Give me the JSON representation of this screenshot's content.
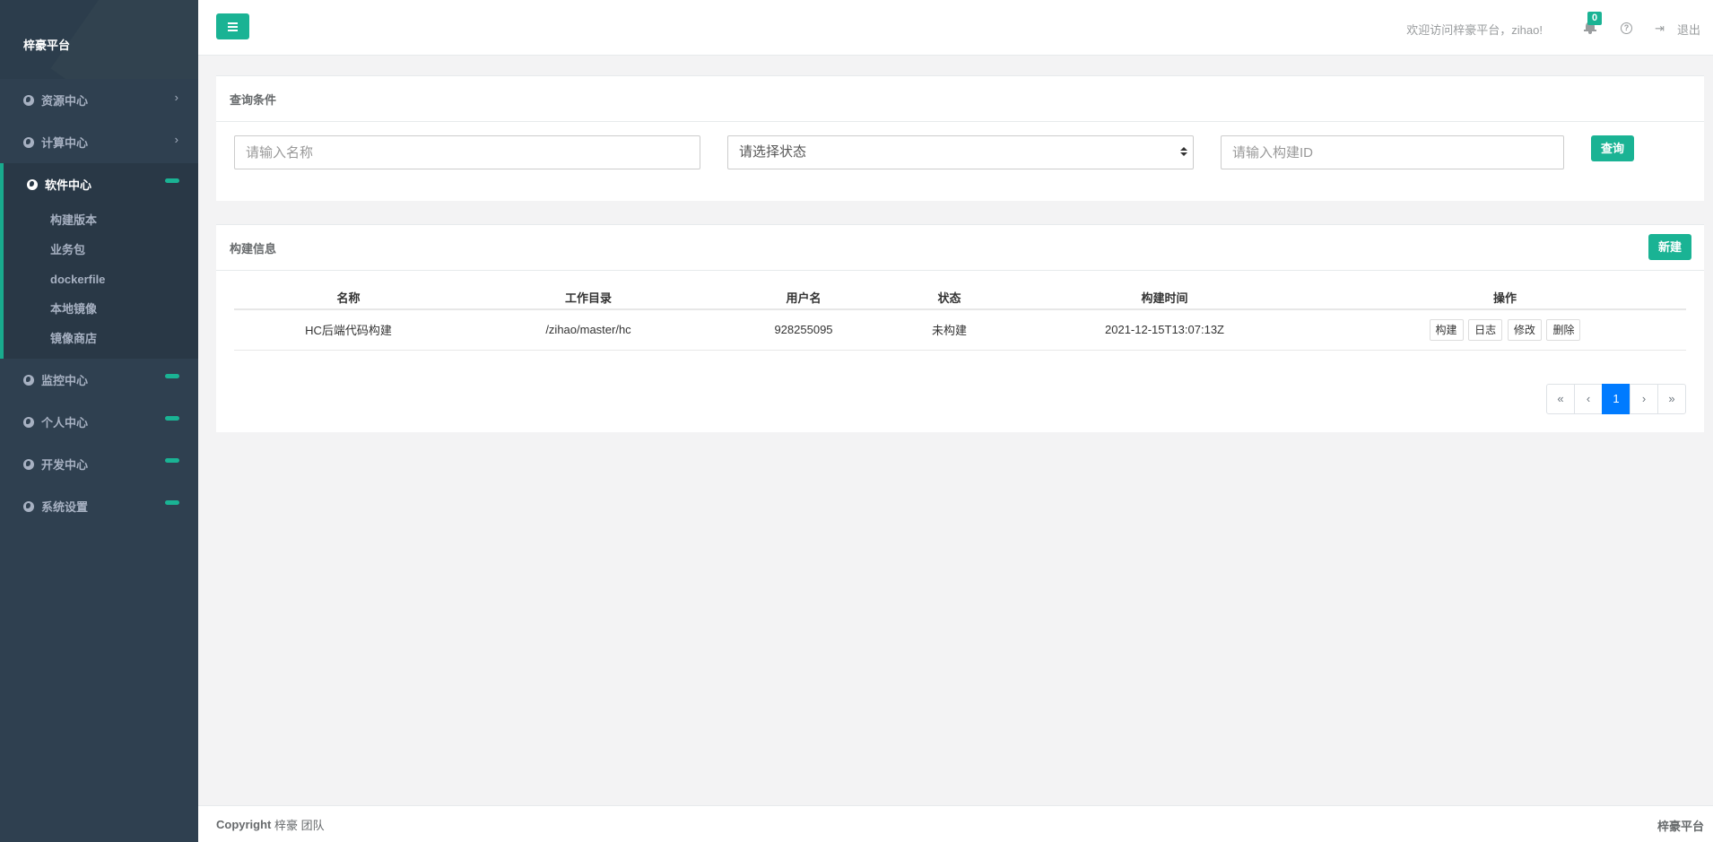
{
  "sidebar": {
    "brand": "梓豪平台",
    "items": [
      {
        "label": "资源中心",
        "marker": "arrow"
      },
      {
        "label": "计算中心",
        "marker": "arrow"
      }
    ],
    "active": {
      "label": "软件中心",
      "children": [
        "构建版本",
        "业务包",
        "dockerfile",
        "本地镜像",
        "镜像商店"
      ]
    },
    "after": [
      {
        "label": "监控中心"
      },
      {
        "label": "个人中心"
      },
      {
        "label": "开发中心"
      },
      {
        "label": "系统设置"
      }
    ],
    "arrow_glyph": "›"
  },
  "topbar": {
    "welcome": "欢迎访问梓豪平台，zihao!",
    "notification_count": "0",
    "help_glyph": "?",
    "logout_glyph": "⇥",
    "logout_label": "退出"
  },
  "query": {
    "title": "查询条件",
    "name_placeholder": "请输入名称",
    "status_placeholder": "请选择状态",
    "build_id_placeholder": "请输入构建ID",
    "search_label": "查询"
  },
  "builds": {
    "title": "构建信息",
    "new_label": "新建",
    "columns": [
      "名称",
      "工作目录",
      "用户名",
      "状态",
      "构建时间",
      "操作"
    ],
    "rows": [
      {
        "name": "HC后端代码构建",
        "workdir": "/zihao/master/hc",
        "username": "928255095",
        "status": "未构建",
        "build_time": "2021-12-15T13:07:13Z",
        "actions": [
          "构建",
          "日志",
          "修改",
          "删除"
        ]
      }
    ],
    "pager": {
      "first": "«",
      "prev": "‹",
      "current": "1",
      "next": "›",
      "last": "»"
    }
  },
  "footer": {
    "copyright_bold": "Copyright",
    "copyright_rest": " 梓豪 团队",
    "right": "梓豪平台"
  },
  "colors": {
    "accent": "#1ab394",
    "sidebar": "#2f4050",
    "pager_active": "#007bff"
  }
}
